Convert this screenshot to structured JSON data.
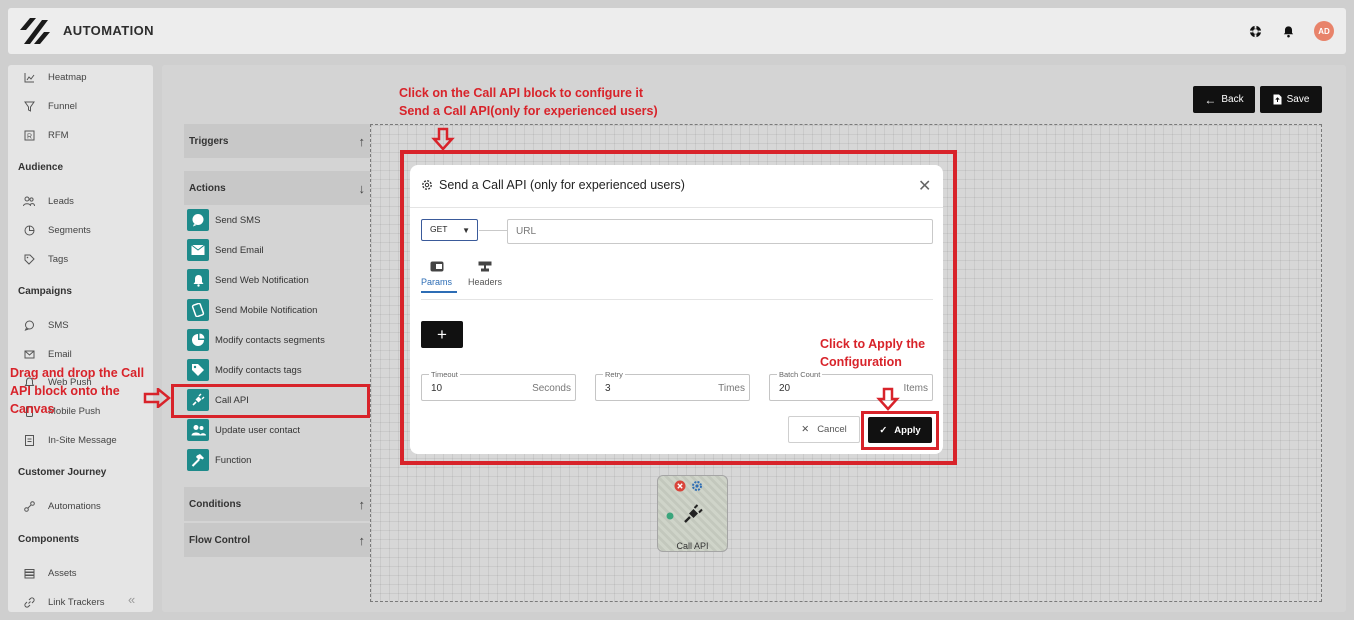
{
  "header": {
    "app_title": "AUTOMATION",
    "avatar_initials": "AD",
    "icons": [
      "support-icon",
      "bell-icon"
    ]
  },
  "sidebar": {
    "items_top": [
      {
        "label": "Heatmap",
        "icon": "heatmap-icon"
      },
      {
        "label": "Funnel",
        "icon": "funnel-icon"
      },
      {
        "label": "RFM",
        "icon": "rfm-icon"
      }
    ],
    "audience": {
      "title": "Audience",
      "items": [
        {
          "label": "Leads",
          "icon": "users-icon"
        },
        {
          "label": "Segments",
          "icon": "pie-icon"
        },
        {
          "label": "Tags",
          "icon": "tag-icon"
        }
      ]
    },
    "campaigns": {
      "title": "Campaigns",
      "items": [
        {
          "label": "SMS",
          "icon": "chat-icon"
        },
        {
          "label": "Email",
          "icon": "mail-icon"
        },
        {
          "label": "Web Push",
          "icon": "bell-icon"
        },
        {
          "label": "Mobile Push",
          "icon": "phone-icon"
        },
        {
          "label": "In-Site Message",
          "icon": "message-icon"
        }
      ]
    },
    "journey": {
      "title": "Customer Journey",
      "items": [
        {
          "label": "Automations",
          "icon": "flow-icon"
        }
      ]
    },
    "components": {
      "title": "Components",
      "items": [
        {
          "label": "Assets",
          "icon": "stack-icon"
        },
        {
          "label": "Link Trackers",
          "icon": "link-icon"
        }
      ]
    },
    "collapse_glyph": "«"
  },
  "toolbar": {
    "back_label": "Back",
    "save_label": "Save"
  },
  "panel": {
    "triggers": {
      "title": "Triggers",
      "arrow": "↑"
    },
    "actions": {
      "title": "Actions",
      "arrow": "↓",
      "items": [
        {
          "label": "Send SMS",
          "icon": "sms-icon"
        },
        {
          "label": "Send Email",
          "icon": "email-icon"
        },
        {
          "label": "Send Web Notification",
          "icon": "web-bell-icon"
        },
        {
          "label": "Send Mobile Notification",
          "icon": "mobile-icon"
        },
        {
          "label": "Modify contacts segments",
          "icon": "segment-icon"
        },
        {
          "label": "Modify contacts tags",
          "icon": "tags-icon"
        },
        {
          "label": "Call API",
          "icon": "plug-icon"
        },
        {
          "label": "Update user contact",
          "icon": "contacts-icon"
        },
        {
          "label": "Function",
          "icon": "hammer-icon"
        }
      ]
    },
    "conditions": {
      "title": "Conditions",
      "arrow": "↑"
    },
    "flow_control": {
      "title": "Flow Control",
      "arrow": "↑"
    }
  },
  "node": {
    "label": "Call API"
  },
  "modal": {
    "title": "Send a Call API (only for experienced users)",
    "method": "GET",
    "url_placeholder": "URL",
    "tabs": [
      {
        "label": "Params",
        "icon": "params-icon",
        "active": true
      },
      {
        "label": "Headers",
        "icon": "headers-icon",
        "active": false
      }
    ],
    "add_label": "+",
    "fields": [
      {
        "label": "Timeout",
        "value": "10",
        "unit": "Seconds"
      },
      {
        "label": "Retry",
        "value": "3",
        "unit": "Times"
      },
      {
        "label": "Batch Count",
        "value": "20",
        "unit": "Items"
      }
    ],
    "cancel_label": "Cancel",
    "apply_label": "Apply"
  },
  "annotations": {
    "top_line1": "Click on the Call API block to configure it",
    "top_line2": "Send a Call API(only for experienced users)",
    "apply_line1": "Click to Apply the",
    "apply_line2": "Configuration",
    "drag_line1": "Drag and drop the Call",
    "drag_line2": "API block onto the",
    "drag_line3": "Canvas",
    "color": "#d8232a"
  },
  "colors": {
    "accent": "#2d6db5",
    "action_icon_bg": "#1e8a8a",
    "avatar_bg": "#e8836a"
  }
}
